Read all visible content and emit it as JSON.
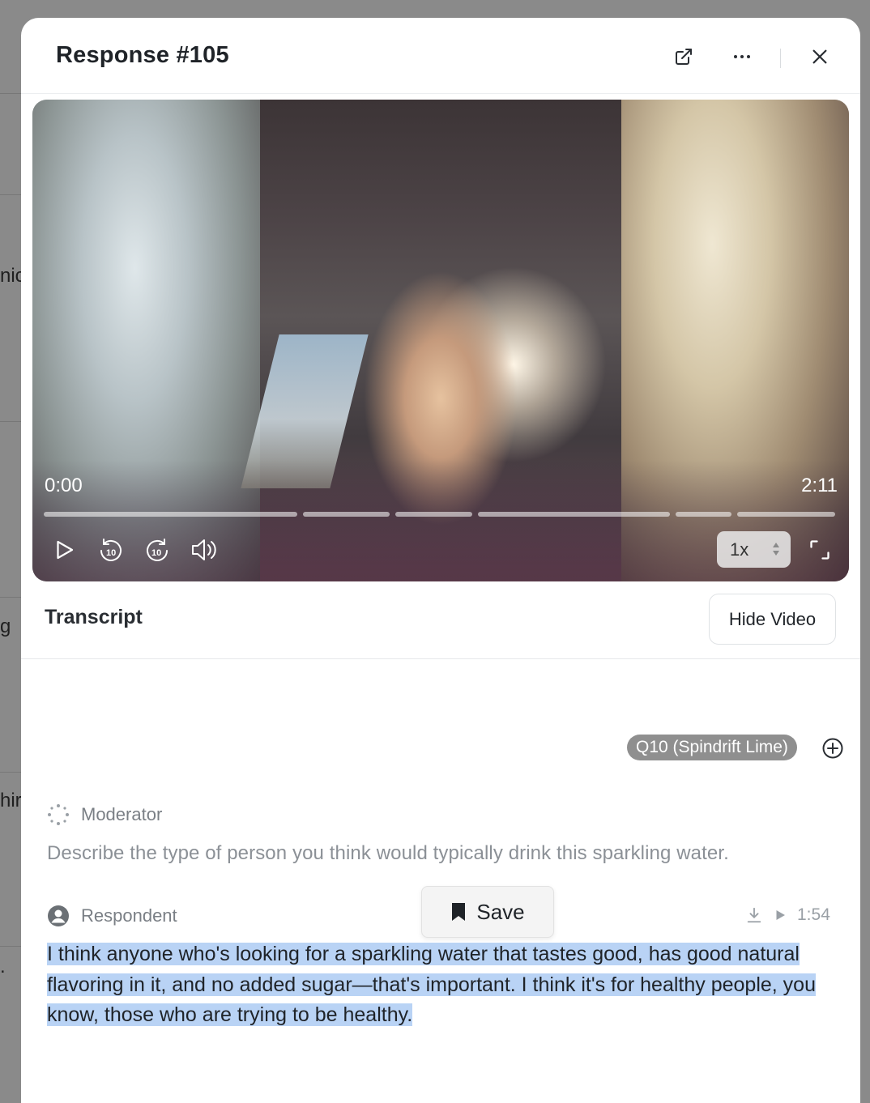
{
  "background": {
    "fragments": [
      "nic",
      "g",
      "hir",
      "."
    ]
  },
  "modal": {
    "title": "Response #105",
    "header_actions": {
      "open_external_icon": "external-link-icon",
      "more_icon": "ellipsis-icon",
      "close_icon": "close-icon"
    }
  },
  "video": {
    "current_time": "0:00",
    "duration": "2:11",
    "progress_segments": 6,
    "speed": "1x",
    "controls": [
      "play-icon",
      "rewind-10-icon",
      "forward-10-icon",
      "volume-icon",
      "fullscreen-icon"
    ]
  },
  "transcript": {
    "title": "Transcript",
    "hide_video_label": "Hide Video",
    "question_tag": "Q10 (Spindrift Lime)",
    "moderator": {
      "label": "Moderator",
      "text": "Describe the type of person you think would typically drink this sparkling water."
    },
    "respondent": {
      "label": "Respondent",
      "timestamp": "1:54",
      "text": "I think anyone who's looking for a sparkling water that tastes good, has good natural flavoring in it, and no added sugar—that's important. I think it's for healthy people, you know, those who are trying to be healthy."
    },
    "save_popup_label": "Save"
  },
  "colors": {
    "selection": "#b9d3f5",
    "tag_bg": "#8f8f8f",
    "overlay": "#8a8a8a"
  }
}
